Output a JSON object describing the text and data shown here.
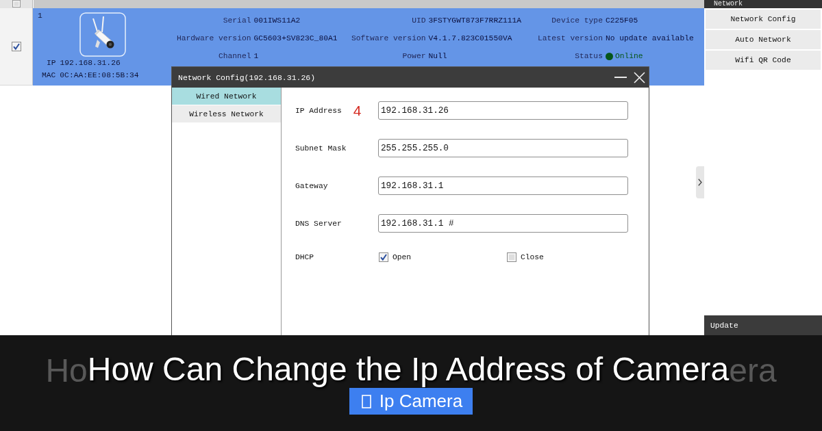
{
  "device_table": {
    "header": {
      "checked": false
    },
    "rows": [
      {
        "index": "1",
        "checked": true,
        "selected": true,
        "ip_label": "IP",
        "ip": "192.168.31.26",
        "mac_label": "MAC",
        "mac": "0C:AA:EE:08:5B:34",
        "groups": [
          {
            "fields": [
              {
                "kind": "text",
                "label": "Serial",
                "value": "001IWS11A2"
              },
              {
                "kind": "text",
                "label": "Hardware version",
                "value": "GC5603+SV823C_80A1"
              },
              {
                "kind": "text",
                "label": "Channel",
                "value": "1"
              }
            ]
          },
          {
            "fields": [
              {
                "kind": "text",
                "label": "UID",
                "value": "3FSTYGWT873F7RRZ111A"
              },
              {
                "kind": "text",
                "label": "Software version",
                "value": "V4.1.7.823C01550VA"
              },
              {
                "kind": "text",
                "label": "Power",
                "value": "Null"
              }
            ]
          },
          {
            "fields": [
              {
                "kind": "text",
                "label": "Device type",
                "value": "C225F05"
              },
              {
                "kind": "text",
                "label": "Latest version",
                "value": "No update available"
              },
              {
                "kind": "status",
                "label": "Status",
                "value": "Online",
                "color": "#06561a"
              }
            ]
          }
        ]
      }
    ]
  },
  "side_panel": {
    "header": "Network",
    "items": [
      "Network Config",
      "Auto Network",
      "Wifi QR Code"
    ],
    "section": "Update"
  },
  "dialog": {
    "title": "Network Config(192.168.31.26)",
    "tabs": [
      {
        "label": "Wired Network",
        "selected": true
      },
      {
        "label": "Wireless Network",
        "selected": false
      }
    ],
    "fields": [
      {
        "label": "IP Address",
        "annotation": "4",
        "value": "192.168.31.26"
      },
      {
        "label": "Subnet Mask",
        "value": "255.255.255.0"
      },
      {
        "label": "Gateway",
        "value": "192.168.31.1"
      },
      {
        "label": "DNS Server",
        "value": "192.168.31.1 #"
      }
    ],
    "dhcp": {
      "label": "DHCP",
      "options": [
        {
          "label": "Open",
          "checked": true
        },
        {
          "label": "Close",
          "checked": false
        }
      ]
    }
  },
  "overlay": {
    "shadow_fragments": [
      "Ho",
      "era"
    ],
    "title": "How Can Change the Ip Address of Camera",
    "tag": "Ip Camera"
  }
}
